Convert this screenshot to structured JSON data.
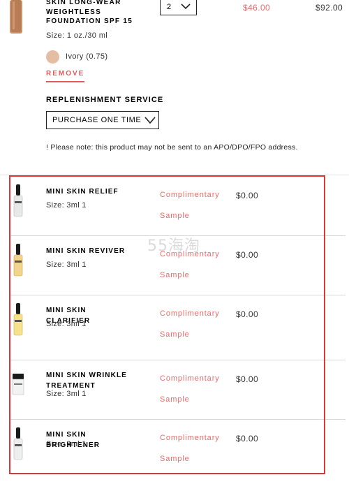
{
  "product": {
    "name": "SKIN LONG-WEAR WEIGHTLESS FOUNDATION SPF 15",
    "size": "Size: 1 oz./30 ml",
    "quantity": "2",
    "unit_price": "$46.00",
    "total_price": "$92.00",
    "shade": "Ivory (0.75)",
    "shade_color": "#e4bda3",
    "remove_label": "REMOVE"
  },
  "replenishment": {
    "title": "REPLENISHMENT SERVICE",
    "selected_option": "PURCHASE ONE TIME"
  },
  "note": "! Please note: this product may not be sent to an APO/DPO/FPO address.",
  "samples": [
    {
      "name": "MINI SKIN RELIEF",
      "size": "Size: 3ml 1",
      "label_line1": "Complimentary",
      "label_line2": "Sample",
      "price": "$0.00"
    },
    {
      "name": "MINI SKIN REVIVER",
      "size": "Size: 3ml 1",
      "label_line1": "Complimentary",
      "label_line2": "Sample",
      "price": "$0.00"
    },
    {
      "name": "MINI SKIN CLARIFIER",
      "size": "Size: 3ml 1",
      "label_line1": "Complimentary",
      "label_line2": "Sample",
      "price": "$0.00"
    },
    {
      "name": "MINI SKIN WRINKLE TREATMENT",
      "size": "Size: 3ml 1",
      "label_line1": "Complimentary",
      "label_line2": "Sample",
      "price": "$0.00"
    },
    {
      "name": "MINI SKIN BRIGHTENER",
      "size": "Size: 3ml 1",
      "label_line1": "Complimentary",
      "label_line2": "Sample",
      "price": "$0.00"
    }
  ],
  "watermark": "55海淘",
  "colors": {
    "accent_red": "#e25a5a",
    "highlight_border": "#e03535"
  }
}
